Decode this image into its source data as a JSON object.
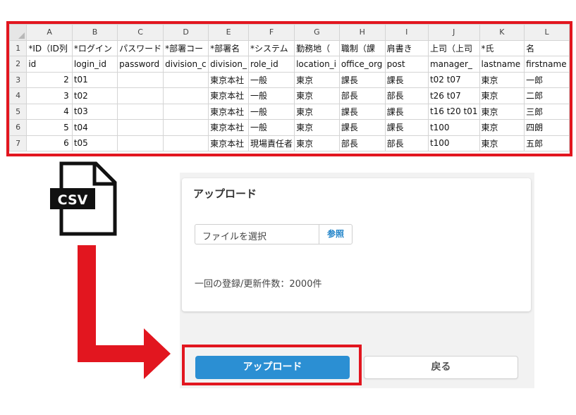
{
  "spreadsheet": {
    "columns": [
      "A",
      "B",
      "C",
      "D",
      "E",
      "F",
      "G",
      "H",
      "I",
      "J",
      "K",
      "L"
    ],
    "rows": [
      {
        "num": "1",
        "cells": [
          "*ID（ID列",
          "*ログイン",
          "パスワード",
          "*部署コー",
          "*部署名",
          "*システム",
          "勤務地（",
          "職制（課",
          "肩書き",
          "上司（上司",
          "*氏",
          "名"
        ]
      },
      {
        "num": "2",
        "cells": [
          "id",
          "login_id",
          "password",
          "division_c",
          "division_",
          "role_id",
          "location_i",
          "office_org",
          "post",
          "manager_",
          "lastname",
          "firstname"
        ]
      },
      {
        "num": "3",
        "cells": [
          "2",
          "t01",
          "",
          "",
          "東京本社",
          "一般",
          "東京",
          "課長",
          "課長",
          "t02 t07",
          "東京",
          "一郎"
        ]
      },
      {
        "num": "4",
        "cells": [
          "3",
          "t02",
          "",
          "",
          "東京本社",
          "一般",
          "東京",
          "部長",
          "部長",
          "t26 t07",
          "東京",
          "二郎"
        ]
      },
      {
        "num": "5",
        "cells": [
          "4",
          "t03",
          "",
          "",
          "東京本社",
          "一般",
          "東京",
          "課長",
          "課長",
          "t16 t20 t01",
          "東京",
          "三郎"
        ]
      },
      {
        "num": "6",
        "cells": [
          "5",
          "t04",
          "",
          "",
          "東京本社",
          "一般",
          "東京",
          "課長",
          "課長",
          "t100",
          "東京",
          "四朗"
        ]
      },
      {
        "num": "7",
        "cells": [
          "6",
          "t05",
          "",
          "",
          "東京本社",
          "現場責任者",
          "東京",
          "部長",
          "部長",
          "t100",
          "東京",
          "五郎"
        ]
      }
    ]
  },
  "csv_icon": {
    "label": "CSV"
  },
  "upload_card": {
    "title": "アップロード",
    "file_placeholder": "ファイルを選択",
    "browse_label": "参照",
    "limit_text": "一回の登録/更新件数：2000件"
  },
  "actions": {
    "upload_label": "アップロード",
    "back_label": "戻る"
  },
  "colors": {
    "highlight_red": "#e2161f",
    "primary_blue": "#2b8fd3",
    "link_blue": "#1e82c8"
  }
}
